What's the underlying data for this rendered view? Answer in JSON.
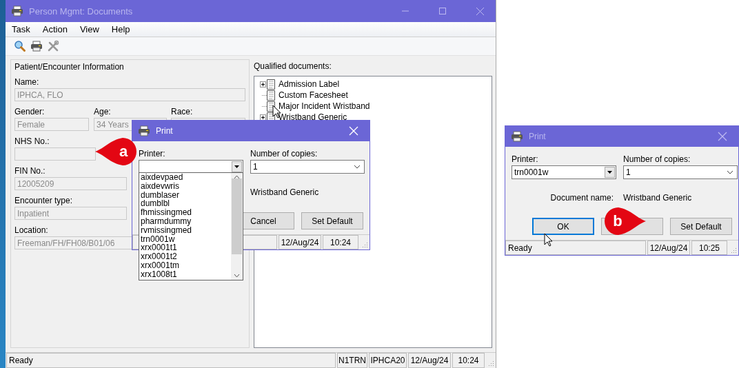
{
  "window": {
    "title": "Person Mgmt: Documents",
    "active": false
  },
  "menu": [
    "Task",
    "Action",
    "View",
    "Help"
  ],
  "patient_panel": {
    "title": "Patient/Encounter Information",
    "name": {
      "label": "Name:",
      "value": "IPHCA, FLO"
    },
    "demographics": [
      {
        "label": "Gender:",
        "value": "Female"
      },
      {
        "label": "Age:",
        "value": "34 Years"
      },
      {
        "label": "Race:"
      }
    ],
    "fields": [
      {
        "label": "NHS No.:"
      },
      {
        "label": "FIN No.:",
        "value": "12005209"
      },
      {
        "label": "Encounter type:",
        "value": "Inpatient"
      },
      {
        "label": "Location:",
        "value": "Freeman/FH/FH08/B01/06"
      }
    ]
  },
  "documents": {
    "label": "Qualified documents:",
    "items": [
      {
        "label": "Admission Label",
        "expandable": true
      },
      {
        "label": "Custom Facesheet",
        "expandable": false
      },
      {
        "label": "Major Incident Wristband",
        "expandable": false
      },
      {
        "label": "Wristband Generic",
        "expandable": true
      }
    ]
  },
  "status_bar": [
    "Ready",
    "N1TRN",
    "IPHCA20",
    "12/Aug/24",
    "10:24"
  ],
  "print_dialog": {
    "title": "Print",
    "active": true,
    "callout": "a",
    "printer_label": "Printer:",
    "copies_label": "Number of copies:",
    "copies_value": "1",
    "document_value": "Wristband Generic",
    "buttons": [
      {
        "label": "Cancel",
        "focused": false
      },
      {
        "label": "Set Default",
        "focused": false
      }
    ],
    "status": [
      "12/Aug/24",
      "10:24"
    ],
    "printer_options": [
      {
        "label": "aixdevpaed",
        "selected": false
      },
      {
        "label": "aixdevwris",
        "selected": false
      },
      {
        "label": "dumblaser",
        "selected": false
      },
      {
        "label": "dumblbl",
        "selected": false
      },
      {
        "label": "fhmissingmed",
        "selected": false
      },
      {
        "label": "pharmdummy",
        "selected": false
      },
      {
        "label": "rvmissingmed",
        "selected": false
      },
      {
        "label": "trn0001w",
        "selected": false
      },
      {
        "label": "xrx0001t1",
        "selected": false
      },
      {
        "label": "xrx0001t2",
        "selected": false
      },
      {
        "label": "xrx0001tm",
        "selected": false
      },
      {
        "label": "xrx1008t1",
        "selected": false
      }
    ]
  },
  "print_dialog_2": {
    "title": "Print",
    "active": false,
    "callout": "b",
    "printer_label": "Printer:",
    "printer_value": "trn0001w",
    "copies_label": "Number of copies:",
    "copies_value": "1",
    "document_label": "Document name:",
    "document_value": "Wristband Generic",
    "buttons": [
      {
        "label": "OK",
        "focused": true
      },
      {
        "focused": false
      },
      {
        "label": "Set Default",
        "focused": false
      }
    ],
    "status": [
      "Ready",
      "12/Aug/24",
      "10:25"
    ]
  }
}
